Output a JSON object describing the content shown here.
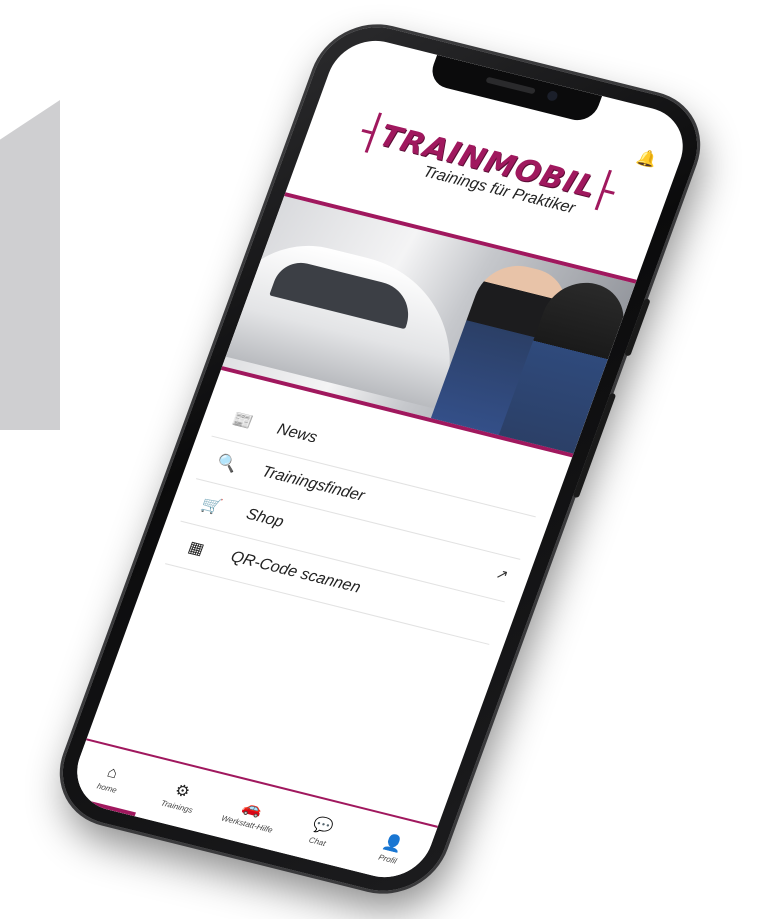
{
  "app": {
    "logo_title": "TRAINMOBIL",
    "logo_subtitle": "Trainings für Praktiker"
  },
  "menu": {
    "items": [
      {
        "label": "News",
        "icon": "newspaper-icon"
      },
      {
        "label": "Trainingsfinder",
        "icon": "search-icon"
      },
      {
        "label": "Shop",
        "icon": "cart-icon",
        "external": true
      },
      {
        "label": "QR-Code scannen",
        "icon": "qr-code-icon"
      }
    ]
  },
  "bottom_nav": {
    "items": [
      {
        "label": "home",
        "icon": "home-icon",
        "active": true
      },
      {
        "label": "Trainings",
        "icon": "trainings-icon"
      },
      {
        "label": "Werkstatt-Hilfe",
        "icon": "car-repair-icon"
      },
      {
        "label": "Chat",
        "icon": "chat-icon"
      },
      {
        "label": "Profil",
        "icon": "profile-icon"
      }
    ]
  },
  "colors": {
    "brand": "#a0185e",
    "text": "#222222"
  }
}
